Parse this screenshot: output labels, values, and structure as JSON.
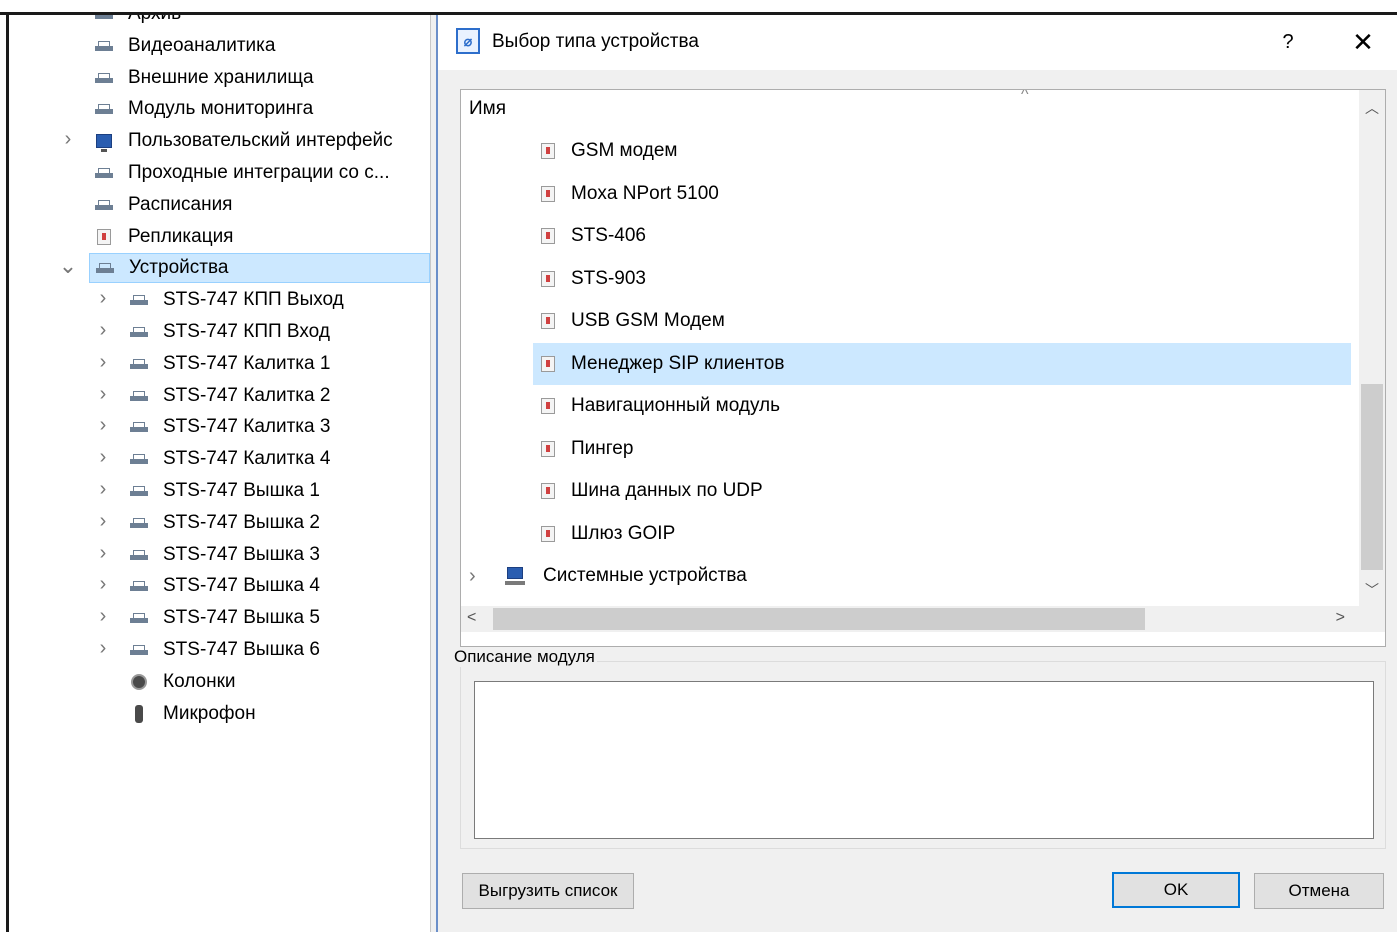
{
  "tree": {
    "items": [
      {
        "label": "Архив",
        "icon": "network-icon"
      },
      {
        "label": "Видеоаналитика",
        "icon": "network-icon"
      },
      {
        "label": "Внешние хранилища",
        "icon": "network-icon"
      },
      {
        "label": "Модуль мониторинга",
        "icon": "network-icon"
      },
      {
        "label": "Пользовательский интерфейс",
        "icon": "monitor-icon",
        "chevron": ">"
      },
      {
        "label": "Проходные интеграции со с...",
        "icon": "network-icon"
      },
      {
        "label": "Расписания",
        "icon": "network-icon"
      },
      {
        "label": "Репликация",
        "icon": "module-icon"
      },
      {
        "label": "Устройства",
        "icon": "network-icon",
        "chevron": "v",
        "selected": true
      },
      {
        "label": "STS-747 КПП Выход",
        "icon": "network-icon",
        "chevron": ">"
      },
      {
        "label": "STS-747 КПП Вход",
        "icon": "network-icon",
        "chevron": ">"
      },
      {
        "label": "STS-747 Калитка 1",
        "icon": "network-icon",
        "chevron": ">"
      },
      {
        "label": "STS-747 Калитка 2",
        "icon": "network-icon",
        "chevron": ">"
      },
      {
        "label": "STS-747 Калитка 3",
        "icon": "network-icon",
        "chevron": ">"
      },
      {
        "label": "STS-747 Калитка 4",
        "icon": "network-icon",
        "chevron": ">"
      },
      {
        "label": "STS-747 Вышка 1",
        "icon": "network-icon",
        "chevron": ">"
      },
      {
        "label": "STS-747 Вышка 2",
        "icon": "network-icon",
        "chevron": ">"
      },
      {
        "label": "STS-747 Вышка 3",
        "icon": "network-icon",
        "chevron": ">"
      },
      {
        "label": "STS-747 Вышка 4",
        "icon": "network-icon",
        "chevron": ">"
      },
      {
        "label": "STS-747 Вышка 5",
        "icon": "network-icon",
        "chevron": ">"
      },
      {
        "label": "STS-747 Вышка 6",
        "icon": "network-icon",
        "chevron": ">"
      },
      {
        "label": "Колонки",
        "icon": "speaker-icon"
      },
      {
        "label": "Микрофон",
        "icon": "microphone-icon"
      }
    ]
  },
  "dialog": {
    "title": "Выбор типа устройства",
    "help_label": "?",
    "close_label": "✕",
    "list": {
      "header": "Имя",
      "items": [
        {
          "label": "GSM модем"
        },
        {
          "label": "Moxa NPort 5100"
        },
        {
          "label": "STS-406"
        },
        {
          "label": "STS-903"
        },
        {
          "label": "USB GSM Модем"
        },
        {
          "label": "Менеджер SIP клиентов",
          "selected": true
        },
        {
          "label": "Навигационный модуль"
        },
        {
          "label": "Пингер"
        },
        {
          "label": "Шина данных по UDP"
        },
        {
          "label": "Шлюз GOIP"
        }
      ],
      "group_item": {
        "label": "Системные устройства",
        "chevron": ">"
      }
    },
    "description_label": "Описание модуля",
    "description_value": "",
    "buttons": {
      "export": "Выгрузить список",
      "ok": "OK",
      "cancel": "Отмена"
    }
  },
  "colors": {
    "selection": "#cce8ff",
    "dialog_border": "#6b8fc9",
    "accent": "#0078d7"
  }
}
